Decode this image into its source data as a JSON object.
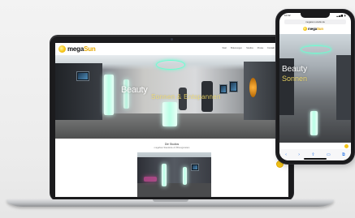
{
  "site": {
    "brand_prefix": "mega",
    "brand_suffix": "Sun",
    "nav": [
      "Start",
      "Bräunungen",
      "Studios",
      "Preise",
      "Kontakt",
      "Shop"
    ],
    "hero_line_1": "Beauty",
    "hero_line_2": "Sonnen & Entspannen",
    "section_title": "Die Studios",
    "section_subtitle": "megaSun Standorte & Öffnungszeiten"
  },
  "phone": {
    "time": "10:32",
    "status": "▂▄▆ ▮",
    "url": "megasun-studio.de",
    "hero_line_1": "Beauty",
    "hero_line_2": "Sonnen",
    "toolbar_icons": [
      "back-icon",
      "forward-icon",
      "share-icon",
      "bookmarks-icon",
      "tabs-icon"
    ],
    "toolbar_glyphs": [
      "‹",
      "›",
      "⇧",
      "▭",
      "⧉"
    ]
  },
  "colors": {
    "brand_yellow": "#f5c518",
    "neon_mint": "#b9ffe6",
    "ios_blue": "#1e6fe6"
  }
}
